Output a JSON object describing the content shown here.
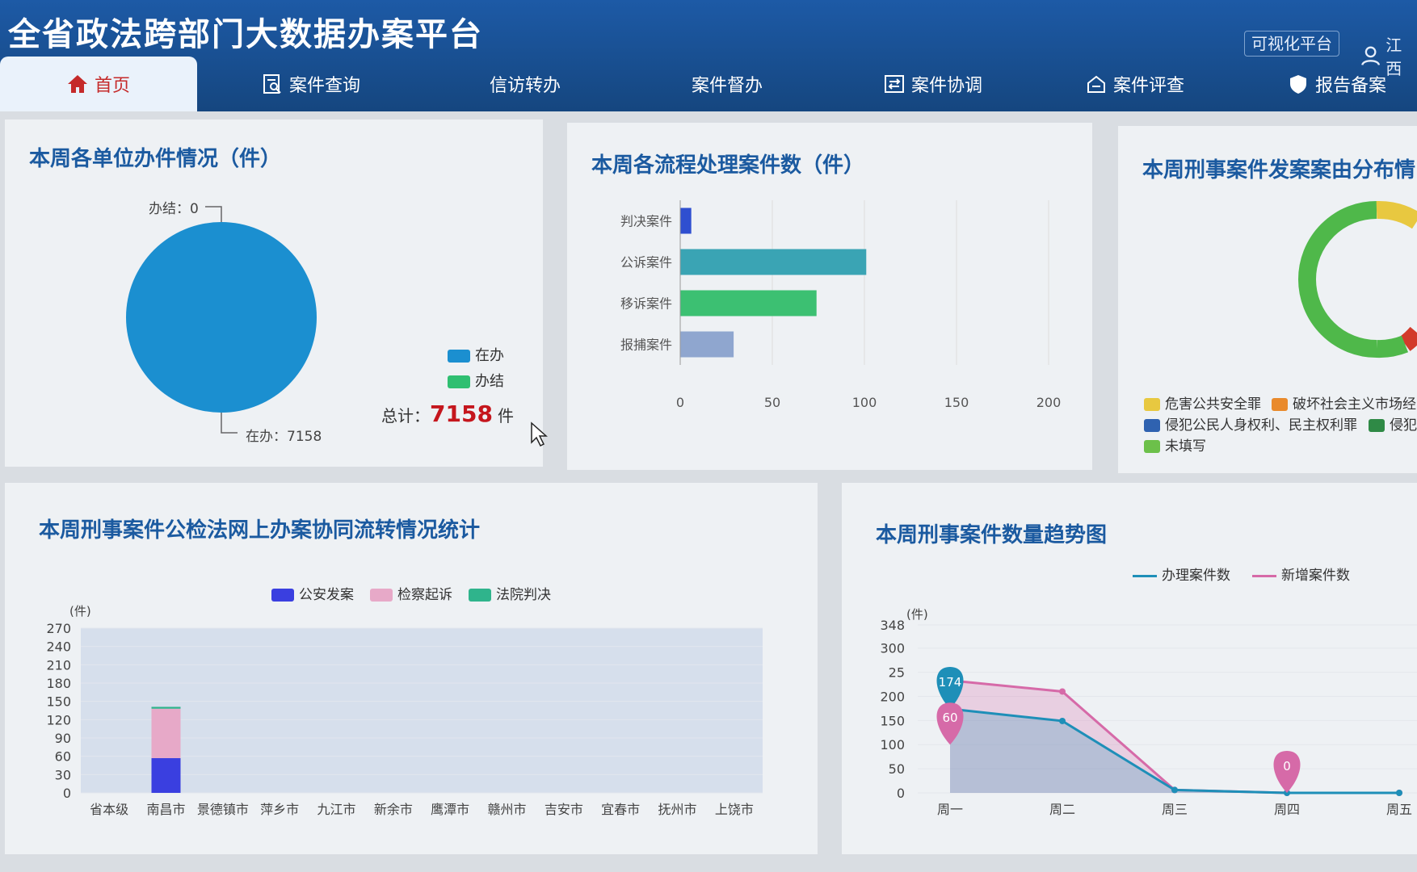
{
  "header": {
    "title": "全省政法跨部门大数据办案平台",
    "viz_button": "可视化平台",
    "user_name": "江西"
  },
  "nav": [
    {
      "label": "首页",
      "icon": "home-icon"
    },
    {
      "label": "案件查询",
      "icon": "search-doc-icon"
    },
    {
      "label": "信访转办",
      "icon": ""
    },
    {
      "label": "案件督办",
      "icon": ""
    },
    {
      "label": "案件协调",
      "icon": "coordination-icon"
    },
    {
      "label": "案件评查",
      "icon": "review-icon"
    },
    {
      "label": "报告备案",
      "icon": "shield-icon"
    }
  ],
  "colors": {
    "blue": "#1b8fd0",
    "green": "#2fbf71",
    "red": "#c5161d",
    "title": "#1b5aa0"
  },
  "panel1": {
    "title": "本周各单位办件情况（件）",
    "label_done": "办结：0",
    "label_doing": "在办：7158",
    "legend": [
      "在办",
      "办结"
    ],
    "total_prefix": "总计：",
    "total_value": "7158",
    "total_suffix": "件",
    "chart_data": {
      "type": "pie",
      "slices": [
        {
          "label": "在办",
          "value": 7158
        },
        {
          "label": "办结",
          "value": 0
        }
      ]
    }
  },
  "panel2": {
    "title": "本周各流程处理案件数（件）",
    "chart_data": {
      "type": "bar",
      "orientation": "horizontal",
      "categories": [
        "判决案件",
        "公诉案件",
        "移诉案件",
        "报捕案件"
      ],
      "values": [
        6,
        101,
        74,
        29
      ],
      "xticks": [
        "0",
        "50",
        "100",
        "150",
        "200"
      ],
      "xlim": [
        0,
        200
      ],
      "colors": [
        "#2f4fd0",
        "#3aa4b4",
        "#3cc072",
        "#8fa6cf"
      ]
    }
  },
  "panel3": {
    "title": "本周刑事案件发案案由分布情",
    "legend": [
      "危害公共安全罪",
      "破坏社会主义市场经",
      "侵犯公民人身权利、民主权利罪",
      "侵犯",
      "未填写"
    ],
    "legend_colors": [
      "#e8c840",
      "#e98a2c",
      "#2f62b0",
      "#2f8a46",
      "#6cc04a"
    ]
  },
  "panel4": {
    "title": "本周刑事案件公检法网上办案协同流转情况统计",
    "legend": [
      "公安发案",
      "检察起诉",
      "法院判决"
    ],
    "legend_colors": [
      "#3a3fe0",
      "#e7a9c8",
      "#2fb48c"
    ],
    "unit": "(件)",
    "chart_data": {
      "type": "bar",
      "stacked": true,
      "categories": [
        "省本级",
        "南昌市",
        "景德镇市",
        "萍乡市",
        "九江市",
        "新余市",
        "鹰潭市",
        "赣州市",
        "吉安市",
        "宜春市",
        "抚州市",
        "上饶市"
      ],
      "yticks": [
        "270",
        "240",
        "210",
        "180",
        "150",
        "120",
        "90",
        "60",
        "30",
        "0"
      ],
      "ylim": [
        0,
        270
      ],
      "series": [
        {
          "name": "公安发案",
          "values": [
            0,
            57,
            0,
            0,
            0,
            0,
            0,
            0,
            0,
            0,
            0,
            0
          ]
        },
        {
          "name": "检察起诉",
          "values": [
            0,
            81,
            0,
            0,
            0,
            0,
            0,
            0,
            0,
            0,
            0,
            0
          ]
        },
        {
          "name": "法院判决",
          "values": [
            0,
            3,
            0,
            0,
            0,
            0,
            0,
            0,
            0,
            0,
            0,
            0
          ]
        }
      ]
    }
  },
  "panel5": {
    "title": "本周刑事案件数量趋势图",
    "legend": [
      "办理案件数",
      "新增案件数"
    ],
    "legend_colors": [
      "#1e8fb8",
      "#d66aa8"
    ],
    "unit": "(件)",
    "chart_data": {
      "type": "line",
      "x": [
        "周一",
        "周二",
        "周三",
        "周四",
        "周五"
      ],
      "yticks": [
        "348",
        "300",
        "25",
        "200",
        "150",
        "100",
        "50",
        "0"
      ],
      "ylim": [
        0,
        348
      ],
      "series": [
        {
          "name": "办理案件数",
          "values": [
            174,
            149,
            6,
            0,
            0
          ]
        },
        {
          "name": "新增案件数",
          "values": [
            233,
            210,
            6,
            0,
            0
          ]
        }
      ],
      "markers": [
        {
          "series": "办理案件数",
          "label": "174",
          "x": "周一",
          "y": 174
        },
        {
          "series": "新增案件数",
          "label": "60",
          "x": "周一",
          "y": 100
        },
        {
          "series": "新增案件数",
          "label": "0",
          "x": "周四",
          "y": 0
        }
      ]
    }
  }
}
